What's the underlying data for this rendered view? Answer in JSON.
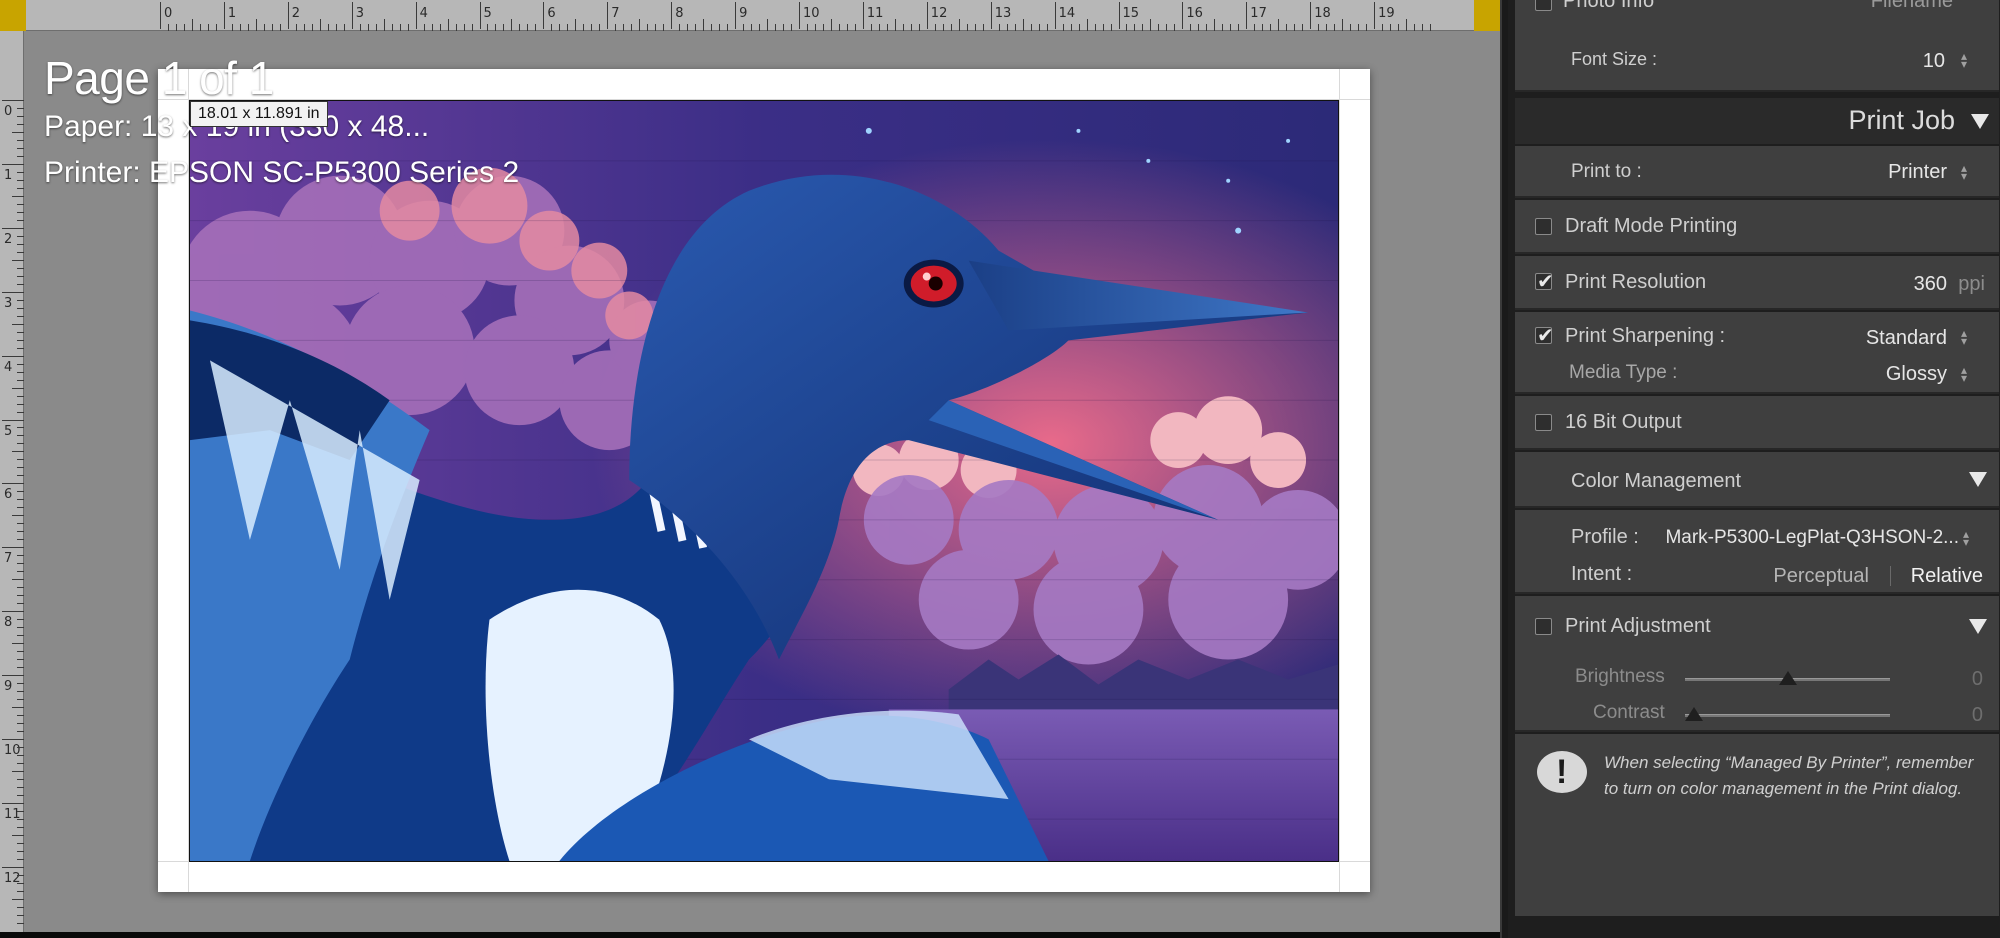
{
  "canvas": {
    "page_label": "Page 1 of 1",
    "paper_line": "Paper:  13 x 19 in (330 x 48...",
    "printer_line": "Printer:  EPSON SC-P5300 Series 2",
    "dimensions_badge": "18.01 x 11.891 in",
    "ruler_top_labels": [
      "0",
      "1",
      "2",
      "3",
      "4",
      "5",
      "6",
      "7",
      "8",
      "9",
      "10",
      "11",
      "12",
      "13",
      "14",
      "15",
      "16",
      "17",
      "18",
      "19"
    ],
    "ruler_left_labels": [
      "0",
      "1",
      "2",
      "3",
      "4",
      "5",
      "6",
      "7",
      "8",
      "9",
      "10",
      "11",
      "12"
    ]
  },
  "panel": {
    "photo_info": {
      "label": "Photo Info",
      "value": "Filename"
    },
    "font_size": {
      "label": "Font Size :",
      "value": "10"
    },
    "print_job_header": "Print Job",
    "print_to": {
      "label": "Print to :",
      "value": "Printer"
    },
    "draft_mode": {
      "label": "Draft Mode Printing",
      "checked": false
    },
    "print_resolution": {
      "label": "Print Resolution",
      "value": "360",
      "unit": "ppi",
      "checked": true
    },
    "print_sharpening": {
      "label": "Print Sharpening :",
      "value": "Standard",
      "checked": true
    },
    "media_type": {
      "label": "Media Type :",
      "value": "Glossy"
    },
    "bit_output": {
      "label": "16 Bit Output",
      "checked": false
    },
    "color_management": {
      "header": "Color Management",
      "profile_label": "Profile :",
      "profile_value": "Mark-P5300-LegPlat-Q3HSON-2...",
      "intent_label": "Intent :",
      "intent_options": [
        "Perceptual",
        "Relative"
      ],
      "intent_selected": "Relative"
    },
    "print_adjustment": {
      "label": "Print Adjustment",
      "checked": false,
      "brightness": {
        "label": "Brightness",
        "value": "0"
      },
      "contrast": {
        "label": "Contrast",
        "value": "0"
      }
    },
    "warning_text": "When selecting “Managed By Printer”, remember to turn on color management in the Print dialog."
  }
}
